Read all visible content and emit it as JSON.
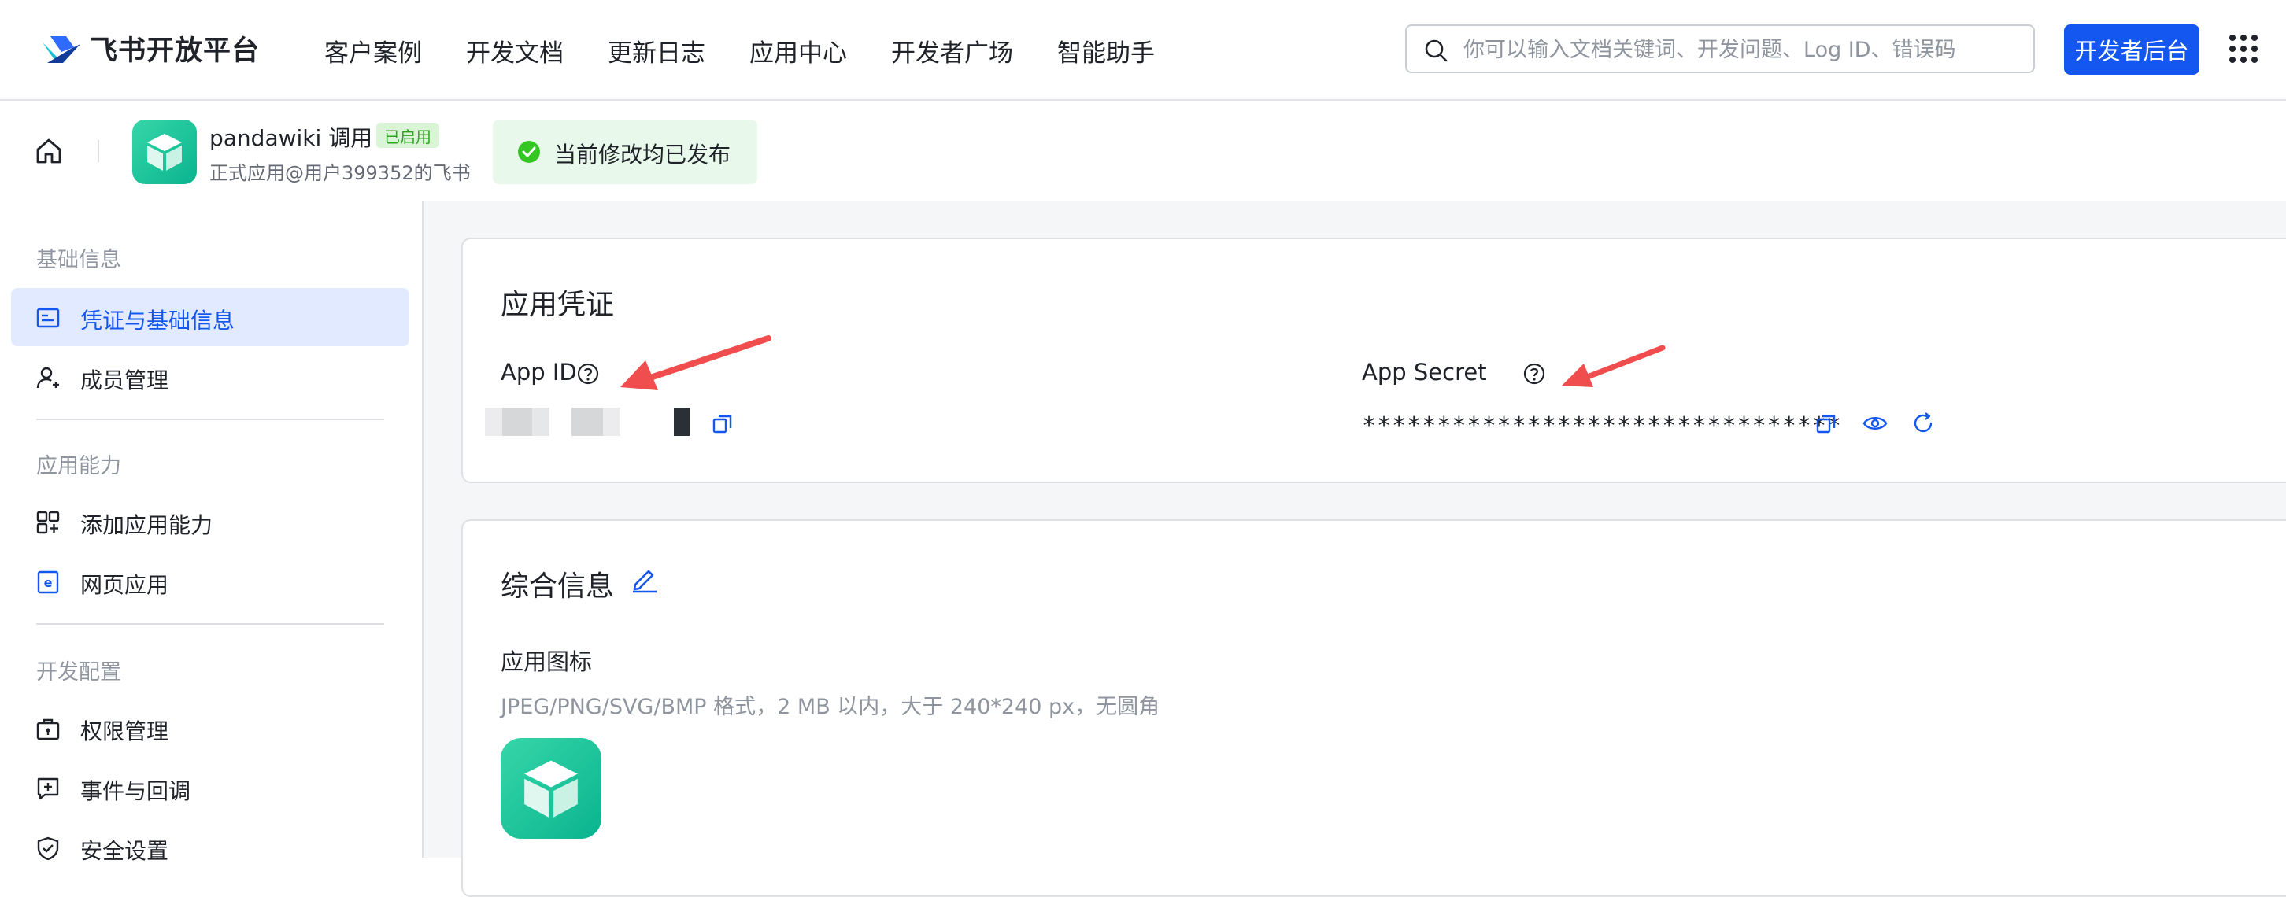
{
  "header": {
    "brand": "飞书开放平台",
    "nav": [
      "客户案例",
      "开发文档",
      "更新日志",
      "应用中心",
      "开发者广场",
      "智能助手"
    ],
    "search_placeholder": "你可以输入文档关键词、开发问题、Log ID、错误码",
    "dev_console_label": "开发者后台"
  },
  "app_bar": {
    "app_name": "pandawiki 调用",
    "status_badge": "已启用",
    "subtitle": "正式应用@用户399352的飞书",
    "publish_status": "当前修改均已发布"
  },
  "sidebar": {
    "sections": [
      {
        "title": "基础信息",
        "items": [
          {
            "label": "凭证与基础信息",
            "icon": "credential-icon",
            "active": true
          },
          {
            "label": "成员管理",
            "icon": "member-icon",
            "active": false
          }
        ]
      },
      {
        "title": "应用能力",
        "items": [
          {
            "label": "添加应用能力",
            "icon": "apps-add-icon",
            "active": false
          },
          {
            "label": "网页应用",
            "icon": "web-app-icon",
            "active": false
          }
        ]
      },
      {
        "title": "开发配置",
        "items": [
          {
            "label": "权限管理",
            "icon": "permission-icon",
            "active": false
          },
          {
            "label": "事件与回调",
            "icon": "event-icon",
            "active": false
          },
          {
            "label": "安全设置",
            "icon": "security-icon",
            "active": false
          }
        ]
      }
    ]
  },
  "credentials": {
    "title": "应用凭证",
    "app_id_label": "App ID",
    "app_secret_label": "App Secret",
    "app_secret_value": "********************************"
  },
  "general_info": {
    "title": "综合信息",
    "app_icon_label": "应用图标",
    "app_icon_hint": "JPEG/PNG/SVG/BMP 格式，2 MB 以内，大于 240*240 px，无圆角"
  },
  "colors": {
    "primary": "#1456f0",
    "success": "#34c724",
    "annotation_arrow": "#f04e4e",
    "app_icon": "#13c49a"
  }
}
